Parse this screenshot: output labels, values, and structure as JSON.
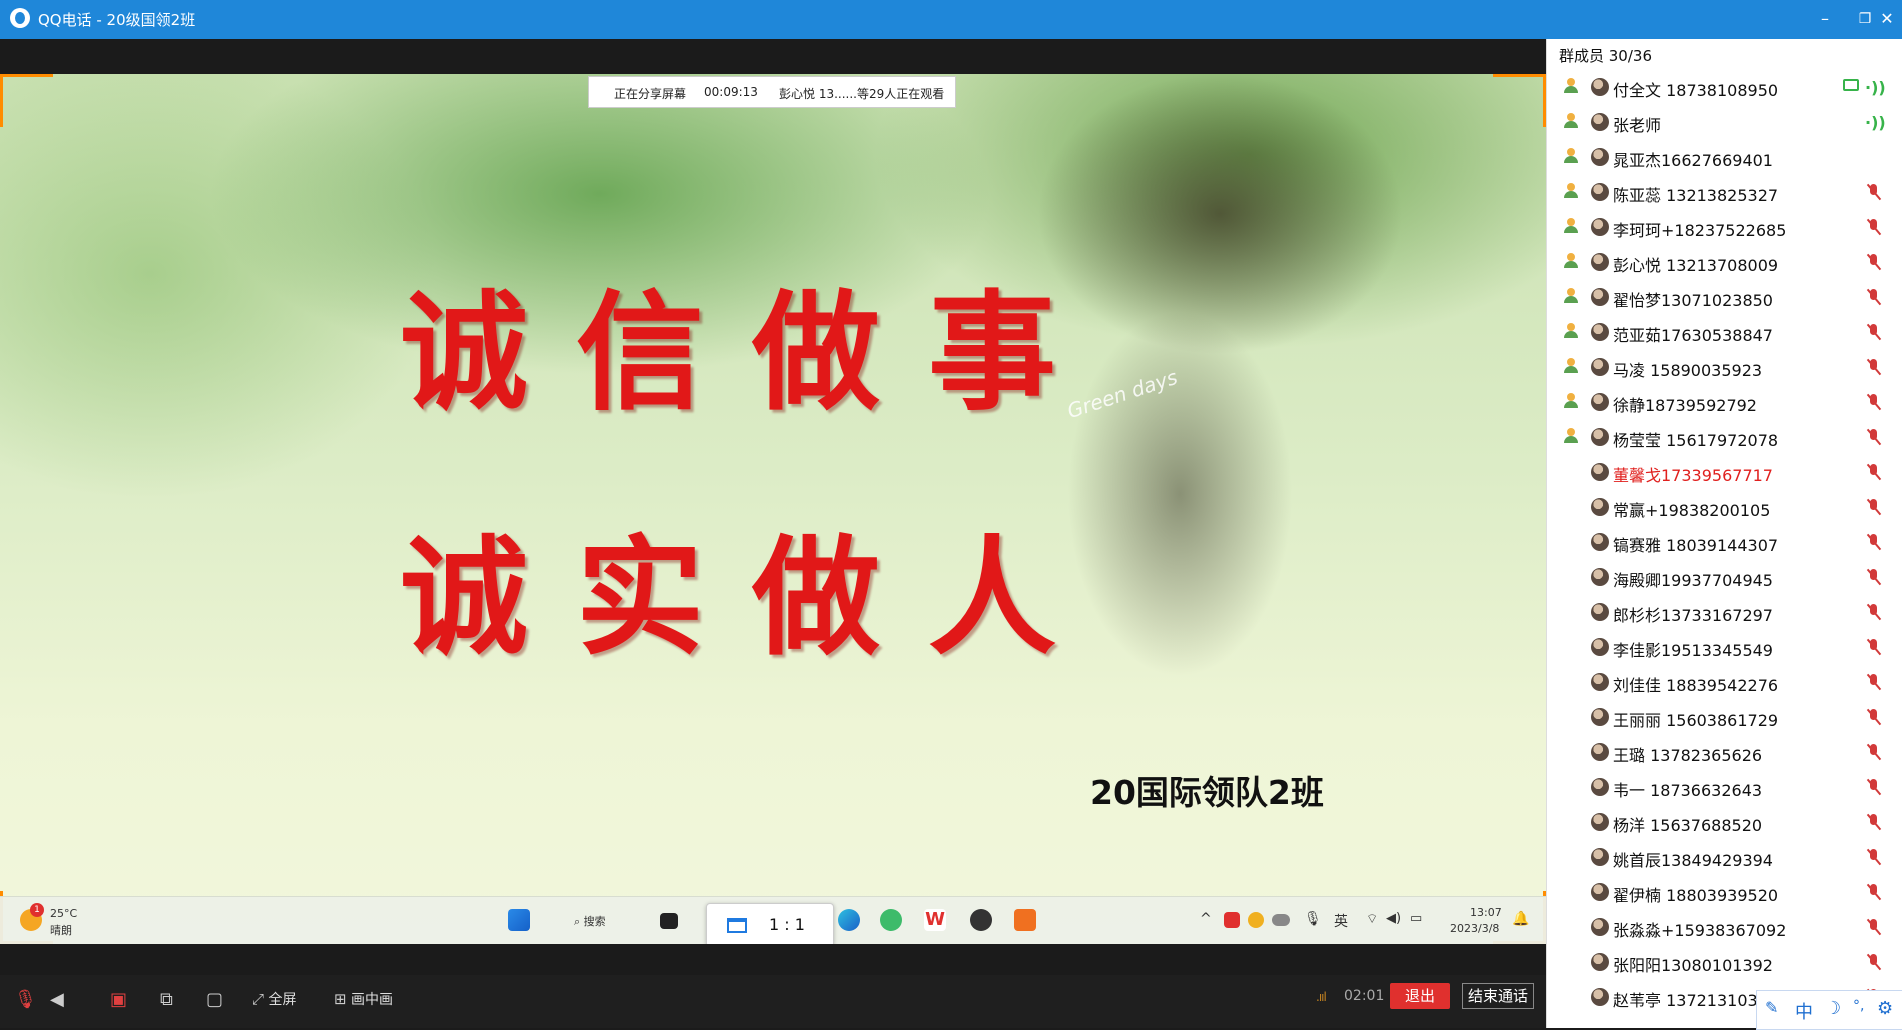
{
  "window": {
    "title": "QQ电话 - 20级国领2班",
    "controls": {
      "minimize": "–",
      "maximize": "❐",
      "close": "✕"
    }
  },
  "share_bar": {
    "status": "正在分享屏幕",
    "elapsed": "00:09:13",
    "viewers": "彭心悦 13......等29人正在观看"
  },
  "slide": {
    "line1": "诚信做事",
    "line2": "诚实做人",
    "class_label": "20国际领队2班",
    "script_text": "Green days"
  },
  "taskbar": {
    "weather_temp": "25°C",
    "weather_desc": "晴朗",
    "weather_badge": "1",
    "search_label": "搜索",
    "ratio_label": "1 : 1",
    "ime_label": "英",
    "clock_time": "13:07",
    "clock_date": "2023/3/8"
  },
  "controls": {
    "fullscreen": "全屏",
    "pip": "画中画",
    "timer": "02:01",
    "exit": "退出",
    "end_call": "结束通话"
  },
  "members_panel": {
    "header": "群成员 30/36",
    "members": [
      {
        "name": "付全文  18738108950",
        "host": true,
        "mic": "on",
        "sharing": true
      },
      {
        "name": "张老师",
        "host": true,
        "mic": "on"
      },
      {
        "name": "晁亚杰16627669401",
        "host": true,
        "mic": "none"
      },
      {
        "name": "陈亚蕊    13213825327",
        "host": true,
        "mic": "off"
      },
      {
        "name": "李珂珂+18237522685",
        "host": true,
        "mic": "off"
      },
      {
        "name": "彭心悦 13213708009",
        "host": true,
        "mic": "off"
      },
      {
        "name": "翟怡梦13071023850",
        "host": true,
        "mic": "off"
      },
      {
        "name": "范亚茹17630538847",
        "host": true,
        "mic": "off"
      },
      {
        "name": "马凌 15890035923",
        "host": true,
        "mic": "off"
      },
      {
        "name": "徐静18739592792",
        "host": true,
        "mic": "off"
      },
      {
        "name": "杨莹莹 15617972078",
        "host": true,
        "mic": "off"
      },
      {
        "name": "董馨戈17339567717",
        "host": false,
        "mic": "off",
        "red": true
      },
      {
        "name": "常赢+19838200105",
        "host": false,
        "mic": "off"
      },
      {
        "name": "镐赛雅 18039144307",
        "host": false,
        "mic": "off"
      },
      {
        "name": "海殿卿19937704945",
        "host": false,
        "mic": "off"
      },
      {
        "name": "郎杉杉13733167297",
        "host": false,
        "mic": "off"
      },
      {
        "name": "李佳影19513345549",
        "host": false,
        "mic": "off"
      },
      {
        "name": "刘佳佳 18839542276",
        "host": false,
        "mic": "off"
      },
      {
        "name": "王丽丽     15603861729",
        "host": false,
        "mic": "off"
      },
      {
        "name": "王璐 13782365626",
        "host": false,
        "mic": "off"
      },
      {
        "name": "韦一 18736632643",
        "host": false,
        "mic": "off"
      },
      {
        "name": "杨洋 15637688520",
        "host": false,
        "mic": "off"
      },
      {
        "name": "姚首辰13849429394",
        "host": false,
        "mic": "off"
      },
      {
        "name": "翟伊楠 18803939520",
        "host": false,
        "mic": "off"
      },
      {
        "name": "张淼淼+15938367092",
        "host": false,
        "mic": "off"
      },
      {
        "name": "张阳阳13080101392",
        "host": false,
        "mic": "off"
      },
      {
        "name": "赵苇亭 13721310322",
        "host": false,
        "mic": "off"
      }
    ]
  },
  "ime_toolbar": {
    "lang": "中",
    "moon": "☽",
    "dot": "°,",
    "gear": "⚙"
  },
  "colors": {
    "titlebar": "#1f87d9",
    "exit_button": "#e0302e",
    "share_frame": "#ff8c00"
  }
}
